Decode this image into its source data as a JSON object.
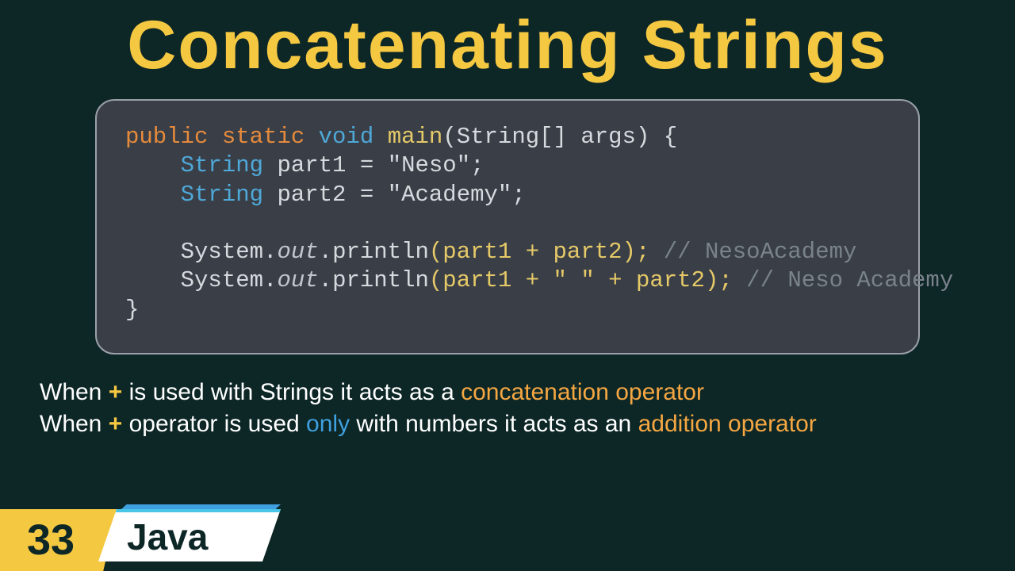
{
  "title": "Concatenating Strings",
  "code": {
    "signature": {
      "public": "public",
      "static": "static",
      "void": "void",
      "main": "main",
      "params": "(String[] args) {"
    },
    "line2": {
      "type": "String",
      "rest": " part1 = ",
      "str": "\"Neso\"",
      "semi": ";"
    },
    "line3": {
      "type": "String",
      "rest": " part2 = ",
      "str": "\"Academy\"",
      "semi": ";"
    },
    "line5": {
      "sys": "System.",
      "out": "out",
      "print": ".println",
      "args": "(part1 + part2);",
      "comment": " // NesoAcademy"
    },
    "line6": {
      "sys": "System.",
      "out": "out",
      "print": ".println",
      "args": "(part1 + \" \" + part2);",
      "comment": " // Neso Academy"
    },
    "close": "}"
  },
  "explain": {
    "line1": {
      "p1": "When ",
      "plus": "+",
      "p2": " is used with Strings it acts as a ",
      "hl": "concatenation operator"
    },
    "line2": {
      "p1": "When ",
      "plus": "+",
      "p2": " operator is used ",
      "only": "only",
      "p3": " with numbers it acts as an ",
      "hl": "addition operator"
    }
  },
  "footer": {
    "num": "33",
    "lang": "Java"
  }
}
